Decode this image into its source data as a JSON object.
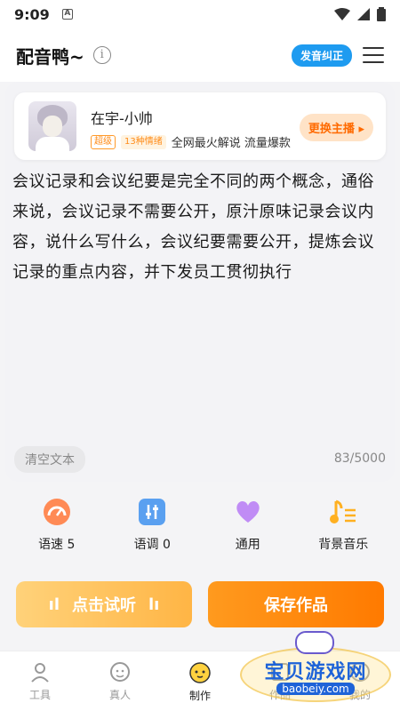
{
  "status_bar": {
    "time": "9:09",
    "notif_glyph": "A"
  },
  "header": {
    "title": "配音鸭~",
    "info_glyph": "i",
    "pron_button": "发音纠正"
  },
  "voice": {
    "name": "在宇-小帅",
    "level_tag": "超级",
    "emotion_tag": "13种情绪",
    "description": "全网最火解说 流量爆款",
    "change_button": "更换主播"
  },
  "script": {
    "text": "会议记录和会议纪要是完全不同的两个概念，通俗来说，会议记录不需要公开，原汁原味记录会议内容，说什么写什么，会议纪要需要公开，提炼会议记录的重点内容，并下发员工贯彻执行",
    "clear_button": "清空文本",
    "counter": "83/5000"
  },
  "tools": [
    {
      "label": "语速 5",
      "icon": "speedometer-icon",
      "color": "#ff7a45"
    },
    {
      "label": "语调 0",
      "icon": "equalizer-icon",
      "color": "#4a90e2"
    },
    {
      "label": "通用",
      "icon": "heart-icon",
      "color": "#b17cf0"
    },
    {
      "label": "背景音乐",
      "icon": "music-note-icon",
      "color": "#ffb020"
    }
  ],
  "actions": {
    "listen": "点击试听",
    "save": "保存作品"
  },
  "nav": [
    {
      "label": "工具",
      "icon": "tools-icon"
    },
    {
      "label": "真人",
      "icon": "person-face-icon"
    },
    {
      "label": "制作",
      "icon": "produce-icon",
      "active": true
    },
    {
      "label": "作品",
      "icon": "works-icon"
    },
    {
      "label": "我的",
      "icon": "profile-icon"
    }
  ],
  "watermark": {
    "text": "宝贝游戏网",
    "url": "baobeiy.com"
  }
}
